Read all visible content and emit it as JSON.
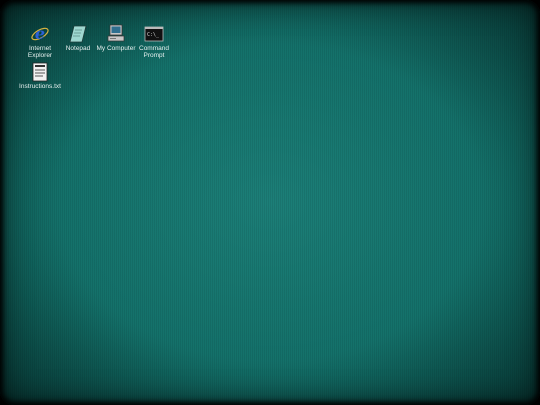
{
  "desktop": {
    "background_color": "#157268",
    "icons": [
      {
        "label": "Internet Explorer",
        "icon": "internet-explorer-icon"
      },
      {
        "label": "Notepad",
        "icon": "notepad-icon"
      },
      {
        "label": "My Computer",
        "icon": "my-computer-icon"
      },
      {
        "label": "Command Prompt",
        "icon": "command-prompt-icon"
      },
      {
        "label": "Instructions.txt",
        "icon": "text-file-icon"
      }
    ]
  }
}
